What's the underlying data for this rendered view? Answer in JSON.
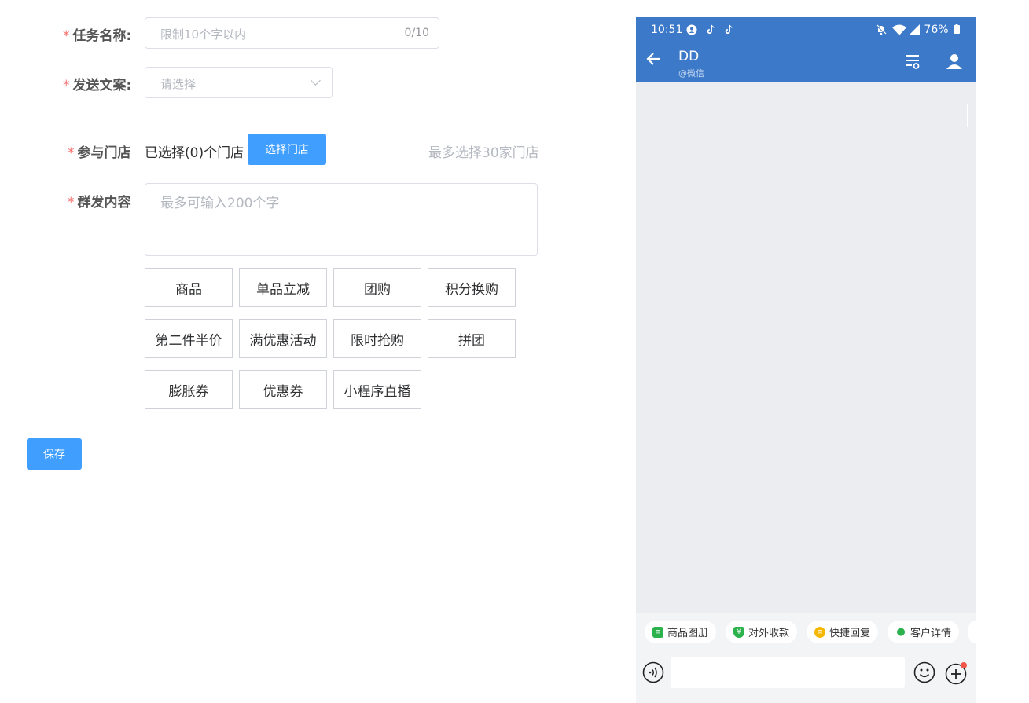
{
  "form": {
    "task_name": {
      "label": "任务名称:",
      "placeholder": "限制10个字以内",
      "counter": "0/10"
    },
    "copy": {
      "label": "发送文案:",
      "placeholder": "请选择"
    },
    "stores": {
      "label": "参与门店",
      "selected": "已选择(0)个门店",
      "button": "选择门店",
      "hint": "最多选择30家门店"
    },
    "content": {
      "label": "群发内容",
      "placeholder": "最多可输入200个字"
    },
    "chips": [
      "商品",
      "单品立减",
      "团购",
      "积分换购",
      "第二件半价",
      "满优惠活动",
      "限时抢购",
      "拼团",
      "膨胀券",
      "优惠券",
      "小程序直播"
    ],
    "save": "保存",
    "required_mark": "*"
  },
  "phone": {
    "status": {
      "time": "10:51",
      "battery": "76%"
    },
    "chat": {
      "name": "DD",
      "source": "@微信"
    },
    "tools": [
      {
        "label": "商品图册",
        "icon": "catalog-icon",
        "color": "#2bb24c"
      },
      {
        "label": "对外收款",
        "icon": "payment-icon",
        "color": "#2bb24c"
      },
      {
        "label": "快捷回复",
        "icon": "quick-reply-icon",
        "color": "#f5b800"
      },
      {
        "label": "客户详情",
        "icon": "customer-icon",
        "color": "#2bb24c"
      }
    ]
  },
  "colors": {
    "primary": "#409eff",
    "header": "#3c79c8",
    "required": "#f56c6c"
  }
}
